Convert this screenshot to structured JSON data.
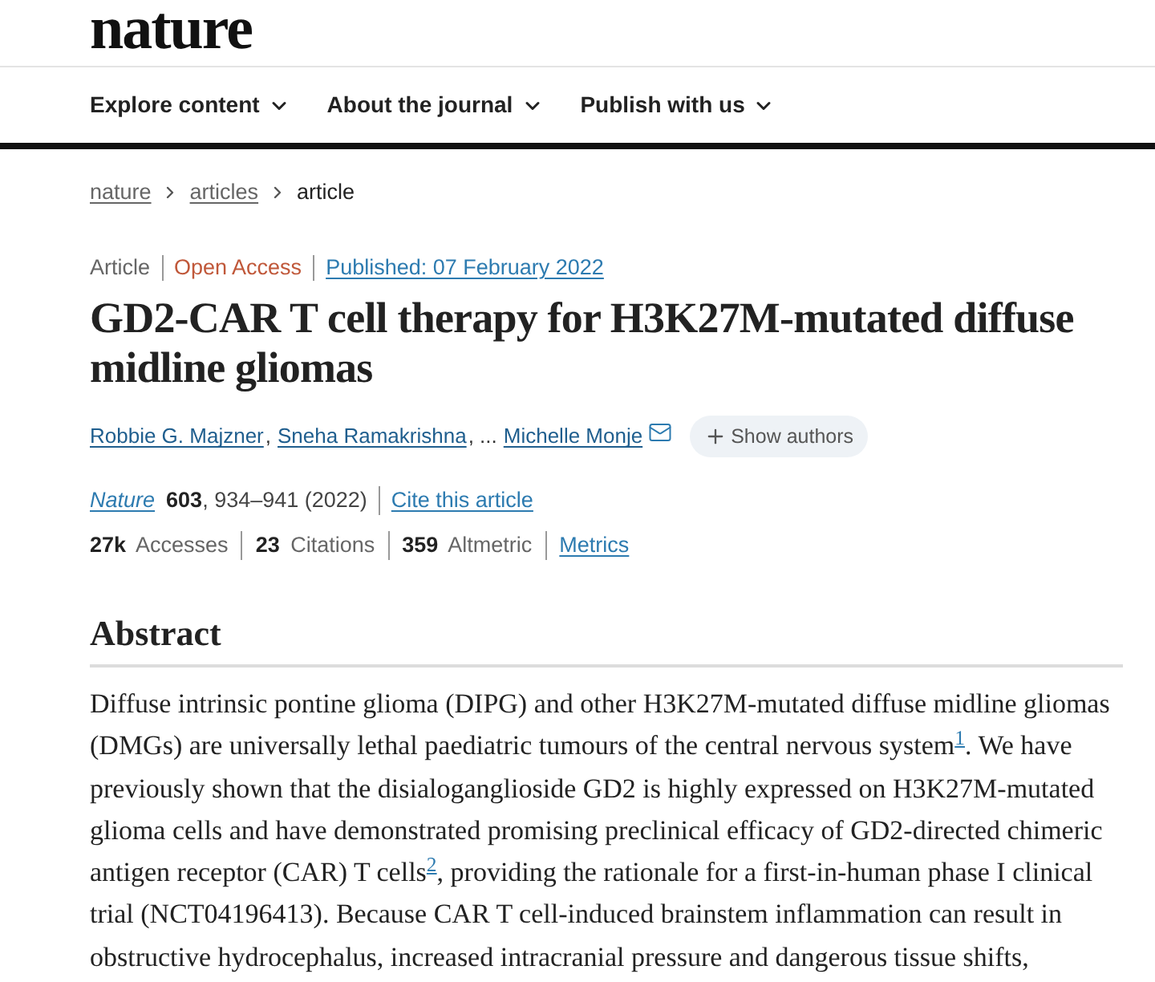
{
  "logo": {
    "text": "nature"
  },
  "nav": [
    {
      "label": "Explore content"
    },
    {
      "label": "About the journal"
    },
    {
      "label": "Publish with us"
    }
  ],
  "breadcrumb": [
    {
      "label": "nature",
      "kind": "link"
    },
    {
      "label": "articles",
      "kind": "link"
    },
    {
      "label": "article",
      "kind": "current"
    }
  ],
  "article_meta": {
    "type": "Article",
    "access": "Open Access",
    "published": "Published: 07 February 2022"
  },
  "title": "GD2-CAR T cell therapy for H3K27M-mutated diffuse midline gliomas",
  "authors": [
    {
      "name": "Robbie G. Majzner",
      "separator": ",",
      "corresponding": false
    },
    {
      "name": "Sneha Ramakrishna",
      "separator": ", ...",
      "corresponding": false
    },
    {
      "name": "Michelle Monje",
      "corresponding": true
    }
  ],
  "show_authors_button": {
    "label": "Show authors"
  },
  "citation": {
    "journal": "Nature",
    "details": "**603**, 934–941 (2022)",
    "cite_link": "Cite this article"
  },
  "metrics": [
    "**27k** Accesses",
    "**23** Citations",
    "**359** Altmetric"
  ],
  "metrics_link": "Metrics",
  "abstract": {
    "heading": "Abstract",
    "paragraph": [
      {
        "kind": "text",
        "text": "Diffuse intrinsic pontine glioma (DIPG) and other H3K27M-mutated diffuse midline gliomas (DMGs) are universally lethal paediatric tumours of the central nervous system"
      },
      {
        "kind": "ref",
        "text": "1"
      },
      {
        "kind": "text",
        "text": ". We have previously shown that the disialoganglioside GD2 is highly expressed on H3K27M-mutated glioma cells and have demonstrated promising preclinical efficacy of GD2-directed chimeric antigen receptor (CAR) T cells"
      },
      {
        "kind": "ref",
        "text": "2"
      },
      {
        "kind": "text",
        "text": ", providing the rationale for a first-in-human phase I clinical trial (NCT04196413). Because CAR T cell-induced brainstem inflammation can result in obstructive hydrocephalus, increased intracranial pressure and dangerous tissue shifts,"
      }
    ]
  }
}
